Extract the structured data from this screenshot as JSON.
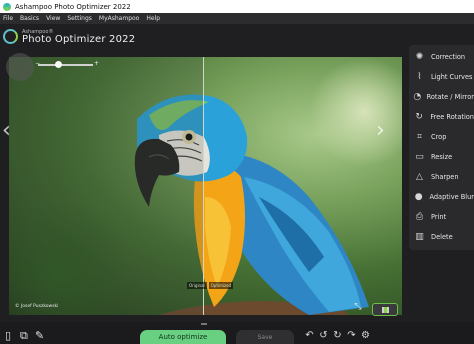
{
  "window": {
    "title": "Ashampoo Photo Optimizer 2022"
  },
  "menu": [
    "File",
    "Basics",
    "View",
    "Settings",
    "MyAshampoo",
    "Help"
  ],
  "brand": {
    "small": "Ashampoo®",
    "big": "Photo Optimizer 2022"
  },
  "viewer": {
    "credit": "© Josef Puszkowski",
    "split_labels": [
      "Original",
      "Optimized"
    ],
    "zoom_level": 0.3
  },
  "tools": [
    {
      "label": "Correction",
      "icon": "correction-icon"
    },
    {
      "label": "Light Curves",
      "icon": "light-curves-icon"
    },
    {
      "label": "Rotate / Mirror",
      "icon": "rotate-mirror-icon"
    },
    {
      "label": "Free Rotation",
      "icon": "free-rotation-icon"
    },
    {
      "label": "Crop",
      "icon": "crop-icon"
    },
    {
      "label": "Resize",
      "icon": "resize-icon"
    },
    {
      "label": "Sharpen",
      "icon": "sharpen-icon"
    },
    {
      "label": "Adaptive Blur",
      "icon": "adaptive-blur-icon"
    },
    {
      "label": "Print",
      "icon": "print-icon"
    },
    {
      "label": "Delete",
      "icon": "delete-icon"
    }
  ],
  "bottom": {
    "auto_optimize": "Auto optimize",
    "save": "Save"
  },
  "colors": {
    "accent_green": "#69d082",
    "panel": "#2a2a2c",
    "background": "#1f1f21"
  }
}
